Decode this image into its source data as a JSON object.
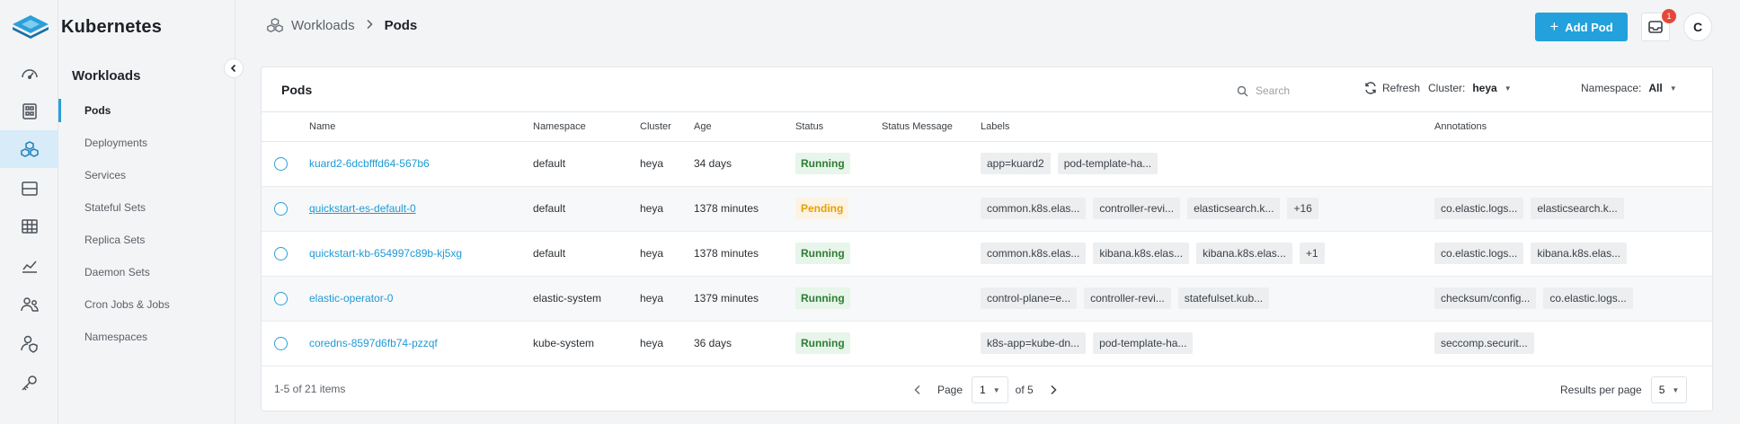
{
  "app": {
    "name": "Kubernetes"
  },
  "rail": {
    "icons": [
      "dashboard-icon",
      "apps-icon",
      "workloads-icon",
      "storage-icon",
      "table-icon",
      "chart-icon",
      "users-icon",
      "user-shield-icon",
      "key-icon"
    ]
  },
  "subnav": {
    "title": "Workloads",
    "items": [
      {
        "label": "Pods"
      },
      {
        "label": "Deployments"
      },
      {
        "label": "Services"
      },
      {
        "label": "Stateful Sets"
      },
      {
        "label": "Replica Sets"
      },
      {
        "label": "Daemon Sets"
      },
      {
        "label": "Cron Jobs & Jobs"
      },
      {
        "label": "Namespaces"
      }
    ]
  },
  "breadcrumb": {
    "parent": "Workloads",
    "current": "Pods"
  },
  "header": {
    "add_label": "Add Pod",
    "notification_count": "1",
    "avatar_initial": "C"
  },
  "card": {
    "title": "Pods",
    "search_placeholder": "Search",
    "refresh_label": "Refresh",
    "cluster_label": "Cluster:",
    "cluster_value": "heya",
    "namespace_label": "Namespace:",
    "namespace_value": "All"
  },
  "table": {
    "columns": {
      "name": "Name",
      "namespace": "Namespace",
      "cluster": "Cluster",
      "age": "Age",
      "status": "Status",
      "status_message": "Status Message",
      "labels": "Labels",
      "annotations": "Annotations"
    },
    "rows": [
      {
        "name": "kuard2-6dcbfffd64-567b6",
        "namespace": "default",
        "cluster": "heya",
        "age": "34 days",
        "status": "Running",
        "labels": [
          "app=kuard2",
          "pod-template-ha..."
        ],
        "annotations": []
      },
      {
        "name": "quickstart-es-default-0",
        "namespace": "default",
        "cluster": "heya",
        "age": "1378 minutes",
        "status": "Pending",
        "labels": [
          "common.k8s.elas...",
          "controller-revi...",
          "elasticsearch.k...",
          "+16"
        ],
        "annotations": [
          "co.elastic.logs...",
          "elasticsearch.k..."
        ]
      },
      {
        "name": "quickstart-kb-654997c89b-kj5xg",
        "namespace": "default",
        "cluster": "heya",
        "age": "1378 minutes",
        "status": "Running",
        "labels": [
          "common.k8s.elas...",
          "kibana.k8s.elas...",
          "kibana.k8s.elas...",
          "+1"
        ],
        "annotations": [
          "co.elastic.logs...",
          "kibana.k8s.elas..."
        ]
      },
      {
        "name": "elastic-operator-0",
        "namespace": "elastic-system",
        "cluster": "heya",
        "age": "1379 minutes",
        "status": "Running",
        "labels": [
          "control-plane=e...",
          "controller-revi...",
          "statefulset.kub..."
        ],
        "annotations": [
          "checksum/config...",
          "co.elastic.logs..."
        ]
      },
      {
        "name": "coredns-8597d6fb74-pzzqf",
        "namespace": "kube-system",
        "cluster": "heya",
        "age": "36 days",
        "status": "Running",
        "labels": [
          "k8s-app=kube-dn...",
          "pod-template-ha..."
        ],
        "annotations": [
          "seccomp.securit..."
        ]
      }
    ]
  },
  "footer": {
    "count_text": "1-5 of 21 items",
    "page_label": "Page",
    "page_value": "1",
    "of_pages": "of 5",
    "rpp_label": "Results per page",
    "rpp_value": "5"
  },
  "colors": {
    "accent": "#22a1dc",
    "running": "#2e7d32",
    "pending": "#e5a100",
    "badge": "#e5483a"
  }
}
